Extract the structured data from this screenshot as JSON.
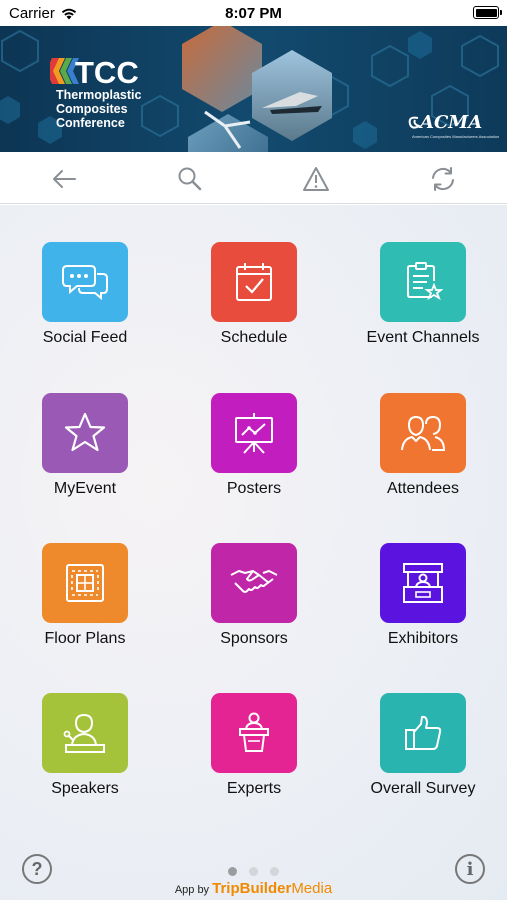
{
  "status_bar": {
    "carrier": "Carrier",
    "time": "8:07 PM"
  },
  "banner": {
    "logo": "TCC",
    "subtitle_lines": [
      "Thermoplastic",
      "Composites",
      "Conference"
    ],
    "partner": "ACMA",
    "partner_tagline": "American Composites Manufacturers Association"
  },
  "toolbar": {
    "back_icon": "arrow-left-icon",
    "search_icon": "search-icon",
    "alert_icon": "warning-icon",
    "refresh_icon": "refresh-icon"
  },
  "tiles": [
    {
      "label": "Social Feed",
      "color": "#3fb3ea",
      "icon": "chat-bubbles-icon"
    },
    {
      "label": "Schedule",
      "color": "#e74c3c",
      "icon": "calendar-check-icon"
    },
    {
      "label": "Event Channels",
      "color": "#2fbcb2",
      "icon": "clipboard-star-icon"
    },
    {
      "label": "MyEvent",
      "color": "#9b59b6",
      "icon": "star-icon"
    },
    {
      "label": "Posters",
      "color": "#c21dbe",
      "icon": "presentation-easel-icon"
    },
    {
      "label": "Attendees",
      "color": "#f07530",
      "icon": "people-icon"
    },
    {
      "label": "Floor Plans",
      "color": "#ef8a2c",
      "icon": "floor-plan-icon"
    },
    {
      "label": "Sponsors",
      "color": "#c026a8",
      "icon": "handshake-icon"
    },
    {
      "label": "Exhibitors",
      "color": "#5b14e0",
      "icon": "booth-icon"
    },
    {
      "label": "Speakers",
      "color": "#a5c33a",
      "icon": "speaker-podium-icon"
    },
    {
      "label": "Experts",
      "color": "#e52493",
      "icon": "lectern-icon"
    },
    {
      "label": "Overall Survey",
      "color": "#2ab4b0",
      "icon": "thumbs-up-icon"
    }
  ],
  "footer": {
    "help": "?",
    "info": "i",
    "page_dots": 3,
    "active_dot": 1,
    "credit_prefix": "App by",
    "credit_brand": "TripBuilder",
    "credit_brand2": "Media"
  }
}
